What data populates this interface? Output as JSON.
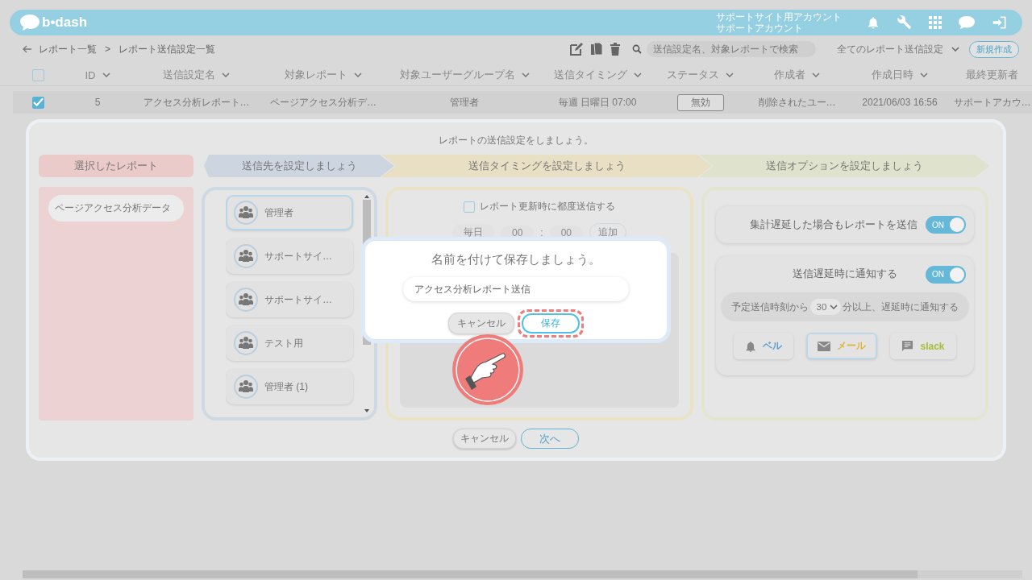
{
  "header": {
    "logo": "b•dash",
    "account": [
      "サポートサイト用アカウント",
      "サポートアカウント"
    ]
  },
  "toolbar": {
    "breadcrumb": [
      "レポート一覧",
      "レポート送信設定一覧"
    ],
    "separator": ">",
    "search_placeholder": "送信設定名、対象レポートで検索",
    "filter": "全てのレポート送信設定",
    "new_button": "新規作成"
  },
  "table": {
    "all_checked": false,
    "columns": [
      {
        "label": "ID",
        "sortable": true
      },
      {
        "label": "送信設定名",
        "sortable": true
      },
      {
        "label": "対象レポート",
        "sortable": true
      },
      {
        "label": "対象ユーザーグループ名",
        "sortable": true
      },
      {
        "label": "送信タイミング",
        "sortable": true
      },
      {
        "label": "ステータス",
        "sortable": true
      },
      {
        "label": "作成者",
        "sortable": true
      },
      {
        "label": "作成日時",
        "sortable": true
      },
      {
        "label": "最終更新者",
        "sortable": false
      }
    ],
    "rows": [
      {
        "checked": true,
        "id": "5",
        "name": "アクセス分析レポート…",
        "report": "ページアクセス分析デ…",
        "group": "管理者",
        "timing": "毎週 日曜日 07:00",
        "status": "無効",
        "creator": "削除されたユー…",
        "created": "2021/06/03 16:56",
        "updater": "サポートアカウ…"
      }
    ]
  },
  "wizard": {
    "title": "レポートの送信設定をしましょう。",
    "steps": [
      {
        "label": "選択したレポート",
        "color": "#ebcaca"
      },
      {
        "label": "送信先を設定しましょう",
        "color": "#ccd5e0"
      },
      {
        "label": "送信タイミングを設定しましょう",
        "color": "#e9dfc4"
      },
      {
        "label": "送信オプションを設定しましょう",
        "color": "#dfe2cc"
      }
    ],
    "report": "ページアクセス分析データ",
    "groups": [
      {
        "name": "管理者",
        "selected": true
      },
      {
        "name": "サポートサイ…",
        "selected": false
      },
      {
        "name": "サポートサイ…",
        "selected": false
      },
      {
        "name": "テスト用",
        "selected": false
      },
      {
        "name": "管理者 (1)",
        "selected": false
      }
    ],
    "timing": {
      "each_update": {
        "label": "レポート更新時に都度送信する",
        "checked": false
      },
      "frequency": "毎日",
      "hour": "00",
      "colon": ":",
      "minute": "00",
      "add_button": "追加"
    },
    "options": [
      {
        "label": "集計遅延した場合もレポートを送信",
        "on": true,
        "on_label": "ON"
      },
      {
        "label": "送信遅延時に通知する",
        "on": true,
        "on_label": "ON"
      }
    ],
    "delay": {
      "before": "予定送信時刻から",
      "value": "30",
      "after": "分以上、遅延時に通知する"
    },
    "channels": [
      {
        "kind": "bell",
        "label": "ベル",
        "selected": false,
        "color": "#5b9fd1"
      },
      {
        "kind": "mail",
        "label": "メール",
        "selected": true,
        "color": "#e0b43c"
      },
      {
        "kind": "slack",
        "label": "slack",
        "selected": false,
        "color": "#a6bf3a"
      }
    ],
    "cancel_button": "キャンセル",
    "next_button": "次へ"
  },
  "dialog": {
    "title": "名前を付けて保存しましょう。",
    "value": "アクセス分析レポート送信",
    "cancel_button": "キャンセル",
    "save_button": "保存",
    "save_highlighted": true
  }
}
